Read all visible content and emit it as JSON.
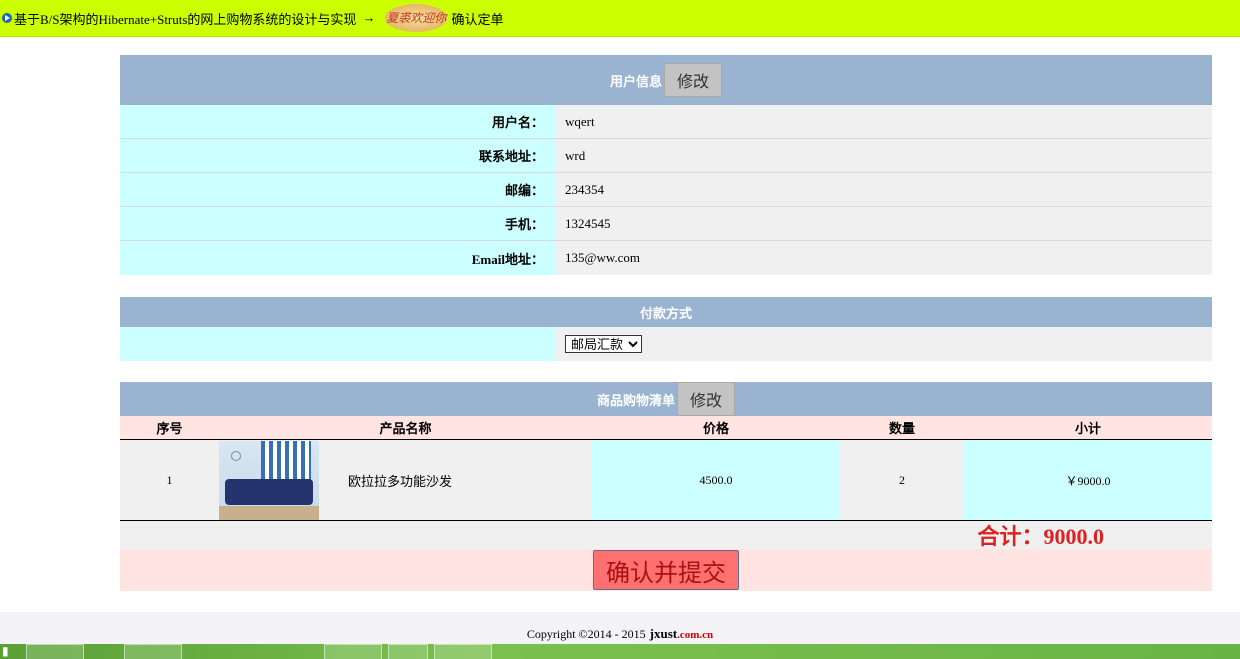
{
  "topbar": {
    "site_title": "基于B/S架构的Hibernate+Struts的网上购物系统的设计与实现",
    "arrow": "→",
    "logo_text": "夏裘欢迎你",
    "page_name": "确认定单"
  },
  "user_info": {
    "section_title": "用户信息",
    "edit_label": "修改",
    "fields": [
      {
        "label": "用户名：",
        "value": "wqert"
      },
      {
        "label": "联系地址：",
        "value": "wrd"
      },
      {
        "label": "邮编：",
        "value": "234354"
      },
      {
        "label": "手机：",
        "value": "1324545"
      },
      {
        "label": "Email地址：",
        "value": "135@ww.com"
      }
    ]
  },
  "payment": {
    "section_title": "付款方式",
    "selected": "邮局汇款"
  },
  "cart": {
    "section_title": "商品购物清单",
    "edit_label": "修改",
    "columns": [
      "序号",
      "产品名称",
      "价格",
      "数量",
      "小计"
    ],
    "rows": [
      {
        "index": "1",
        "name": "欧拉拉多功能沙发",
        "price": "4500.0",
        "qty": "2",
        "subtotal": "￥9000.0"
      }
    ],
    "total_label": "合计：9000.0",
    "submit_label": "确认并提交"
  },
  "footer": {
    "copyright": "Copyright ©2014 - 2015",
    "brand_main": "jxust",
    "brand_suffix": ".com.cn"
  },
  "colors": {
    "topbar": "#ccff00",
    "section_header": "#99b3d1",
    "label_bg": "#ccffff",
    "value_bg": "#f0f0f0",
    "pink_bg": "#ffe4e1",
    "total_red": "#e02020"
  }
}
